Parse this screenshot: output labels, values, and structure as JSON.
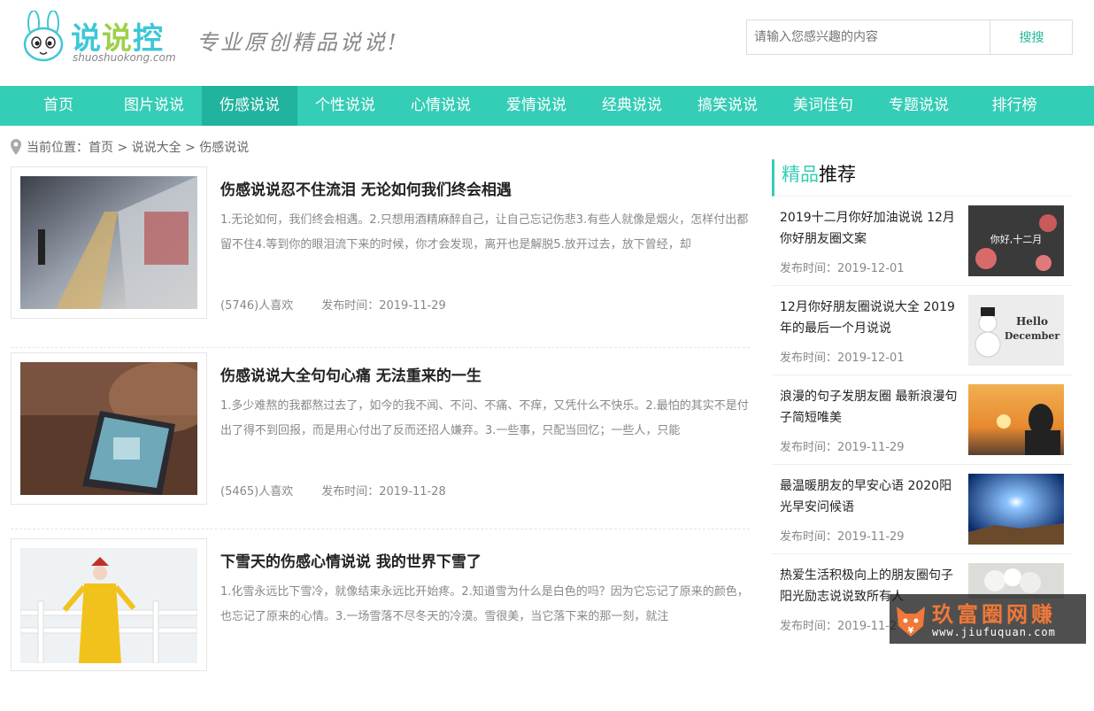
{
  "header": {
    "logo_text": "说说控",
    "logo_text_parts": [
      "说",
      "说",
      "控"
    ],
    "logo_domain": "shuoshuokong.com",
    "slogan": "专业原创精品说说!",
    "search_placeholder": "请输入您感兴趣的内容",
    "search_button": "搜搜"
  },
  "nav": {
    "items": [
      "首页",
      "图片说说",
      "伤感说说",
      "个性说说",
      "心情说说",
      "爱情说说",
      "经典说说",
      "搞笑说说",
      "美词佳句",
      "专题说说",
      "排行榜"
    ],
    "active_index": 2
  },
  "breadcrumb": "当前位置：首页 > 说说大全 > 伤感说说",
  "articles": [
    {
      "title": "伤感说说忍不住流泪 无论如何我们终会相遇",
      "desc": "1.无论如何，我们终会相遇。2.只想用酒精麻醉自己，让自己忘记伤悲3.有些人就像是烟火，怎样付出都留不住4.等到你的眼泪流下来的时候，你才会发现，离开也是解脱5.放开过去，放下曾经，却",
      "likes": "(5746)人喜欢",
      "date": "发布时间：2019-11-29"
    },
    {
      "title": "伤感说说大全句句心痛 无法重来的一生",
      "desc": "1.多少难熬的我都熬过去了，如今的我不闻、不问、不痛、不痒，又凭什么不快乐。2.最怕的其实不是付出了得不到回报，而是用心付出了反而还招人嫌弃。3.一些事，只配当回忆；一些人，只能",
      "likes": "(5465)人喜欢",
      "date": "发布时间：2019-11-28"
    },
    {
      "title": "下雪天的伤感心情说说 我的世界下雪了",
      "desc": "1.化雪永远比下雪冷，就像结束永远比开始疼。2.知道雪为什么是白色的吗？因为它忘记了原来的颜色，也忘记了原来的心情。3.一场雪落不尽冬天的冷漠。雪很美，当它落下来的那一刻，就注",
      "likes": "",
      "date": ""
    }
  ],
  "sidebar": {
    "title_highlight": "精品",
    "title_rest": "推荐",
    "items": [
      {
        "title": "2019十二月你好加油说说 12月你好朋友圈文案",
        "date": "发布时间：2019-12-01",
        "img_text": "你好,十二月"
      },
      {
        "title": "12月你好朋友圈说说大全 2019年的最后一个月说说",
        "date": "发布时间：2019-12-01",
        "img_text": "Hello December"
      },
      {
        "title": "浪漫的句子发朋友圈 最新浪漫句子简短唯美",
        "date": "发布时间：2019-11-29",
        "img_text": ""
      },
      {
        "title": "最温暖朋友的早安心语 2020阳光早安问候语",
        "date": "发布时间：2019-11-29",
        "img_text": ""
      },
      {
        "title": "热爱生活积极向上的朋友圈句子 阳光励志说说致所有人",
        "date": "发布时间：2019-11-2",
        "img_text": ""
      }
    ]
  },
  "watermark": {
    "title": "玖富圈网赚",
    "url": "www.jiufuquan.com"
  },
  "colors": {
    "nav_bg": "#34cdb5",
    "nav_active": "#21b39d",
    "logo_blue": "#3ec7d6",
    "logo_green": "#9ed04a",
    "watermark_orange": "#f07838"
  }
}
